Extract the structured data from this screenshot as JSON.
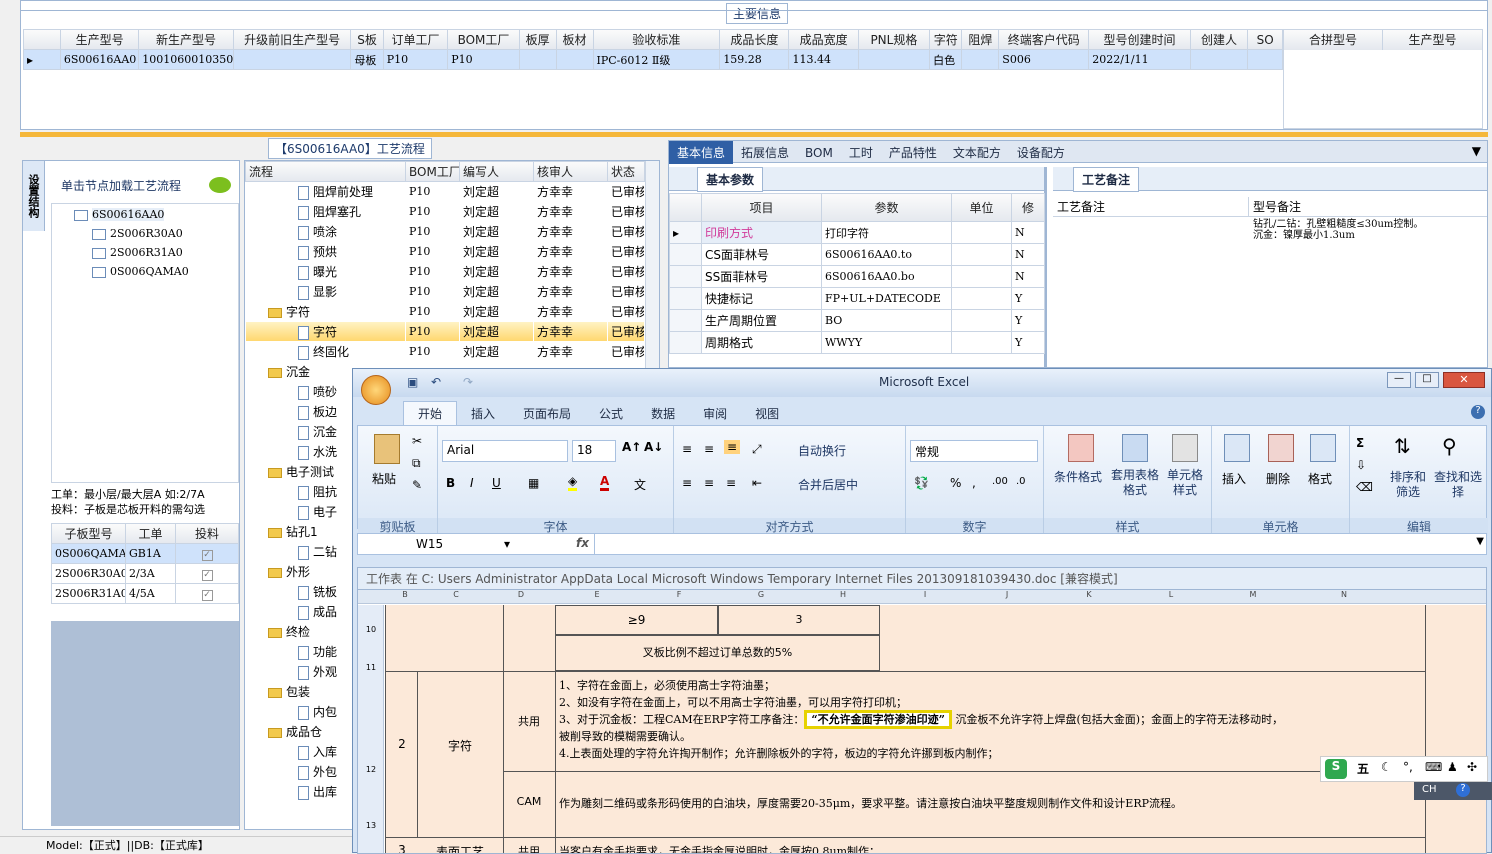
{
  "main_info": {
    "title": "主要信息",
    "columns": [
      "生产型号",
      "新生产型号",
      "升级前旧生产型号",
      "S板",
      "订单工厂",
      "BOM工厂",
      "板厚",
      "板材",
      "验收标准",
      "成品长度",
      "成品宽度",
      "PNL规格",
      "字符",
      "阻焊",
      "终端客户代码",
      "型号创建时间",
      "创建人",
      "SO"
    ],
    "row": [
      "6S00616AA0",
      "10010600103501",
      "",
      "母板",
      "P10",
      "P10",
      "",
      "",
      "IPC-6012 Ⅱ级",
      "159.28",
      "113.44",
      "",
      "白色",
      "",
      "S006",
      "2022/1/11",
      "",
      ""
    ],
    "side_columns": [
      "合拼型号",
      "生产型号"
    ]
  },
  "left_panel": {
    "vertical_tab": "设置结构",
    "hint": "单击节点加载工艺流程",
    "tree": [
      "6S00616AA0",
      "2S006R30A0",
      "2S006R31A0",
      "0S006QAMA0"
    ],
    "note1": "工单：最小层/最大层A 如:2/7A",
    "note2": "投料：子板是芯板开料的需勾选",
    "sub_columns": [
      "子板型号",
      "工单",
      "投料"
    ],
    "sub_rows": [
      [
        "0S006QAMA0",
        "GB1A"
      ],
      [
        "2S006R30A0",
        "2/3A"
      ],
      [
        "2S006R31A0",
        "4/5A"
      ]
    ]
  },
  "flow": {
    "title": "【6S00616AA0】工艺流程",
    "columns": [
      "流程",
      "BOM工厂",
      "编写人",
      "核审人",
      "状态"
    ],
    "rows": [
      {
        "lvl": 2,
        "name": "阻焊前处理",
        "b": "P10",
        "w": "刘定超",
        "r": "方幸幸",
        "s": "已审核"
      },
      {
        "lvl": 2,
        "name": "阻焊塞孔",
        "b": "P10",
        "w": "刘定超",
        "r": "方幸幸",
        "s": "已审核"
      },
      {
        "lvl": 2,
        "name": "喷涂",
        "b": "P10",
        "w": "刘定超",
        "r": "方幸幸",
        "s": "已审核"
      },
      {
        "lvl": 2,
        "name": "预烘",
        "b": "P10",
        "w": "刘定超",
        "r": "方幸幸",
        "s": "已审核"
      },
      {
        "lvl": 2,
        "name": "曝光",
        "b": "P10",
        "w": "刘定超",
        "r": "方幸幸",
        "s": "已审核"
      },
      {
        "lvl": 2,
        "name": "显影",
        "b": "P10",
        "w": "刘定超",
        "r": "方幸幸",
        "s": "已审核"
      },
      {
        "lvl": 1,
        "name": "字符",
        "b": "P10",
        "w": "刘定超",
        "r": "方幸幸",
        "s": "已审核"
      },
      {
        "lvl": 2,
        "name": "字符",
        "b": "P10",
        "w": "刘定超",
        "r": "方幸幸",
        "s": "已审核",
        "sel": true
      },
      {
        "lvl": 2,
        "name": "终固化",
        "b": "P10",
        "w": "刘定超",
        "r": "方幸幸",
        "s": "已审核"
      },
      {
        "lvl": 1,
        "name": "沉金",
        "b": "",
        "w": "",
        "r": "",
        "s": ""
      },
      {
        "lvl": 2,
        "name": "喷砂",
        "b": "",
        "w": "",
        "r": "",
        "s": ""
      },
      {
        "lvl": 2,
        "name": "板边",
        "b": "",
        "w": "",
        "r": "",
        "s": ""
      },
      {
        "lvl": 2,
        "name": "沉金",
        "b": "",
        "w": "",
        "r": "",
        "s": ""
      },
      {
        "lvl": 2,
        "name": "水洗",
        "b": "",
        "w": "",
        "r": "",
        "s": ""
      },
      {
        "lvl": 1,
        "name": "电子测试",
        "b": "",
        "w": "",
        "r": "",
        "s": ""
      },
      {
        "lvl": 2,
        "name": "阻抗",
        "b": "",
        "w": "",
        "r": "",
        "s": ""
      },
      {
        "lvl": 2,
        "name": "电子",
        "b": "",
        "w": "",
        "r": "",
        "s": ""
      },
      {
        "lvl": 1,
        "name": "钻孔1",
        "b": "",
        "w": "",
        "r": "",
        "s": ""
      },
      {
        "lvl": 2,
        "name": "二钻",
        "b": "",
        "w": "",
        "r": "",
        "s": ""
      },
      {
        "lvl": 1,
        "name": "外形",
        "b": "",
        "w": "",
        "r": "",
        "s": ""
      },
      {
        "lvl": 2,
        "name": "铣板",
        "b": "",
        "w": "",
        "r": "",
        "s": ""
      },
      {
        "lvl": 2,
        "name": "成品",
        "b": "",
        "w": "",
        "r": "",
        "s": ""
      },
      {
        "lvl": 1,
        "name": "终检",
        "b": "",
        "w": "",
        "r": "",
        "s": ""
      },
      {
        "lvl": 2,
        "name": "功能",
        "b": "",
        "w": "",
        "r": "",
        "s": ""
      },
      {
        "lvl": 2,
        "name": "外观",
        "b": "",
        "w": "",
        "r": "",
        "s": ""
      },
      {
        "lvl": 1,
        "name": "包装",
        "b": "",
        "w": "",
        "r": "",
        "s": ""
      },
      {
        "lvl": 2,
        "name": "内包",
        "b": "",
        "w": "",
        "r": "",
        "s": ""
      },
      {
        "lvl": 1,
        "name": "成品仓",
        "b": "",
        "w": "",
        "r": "",
        "s": ""
      },
      {
        "lvl": 2,
        "name": "入库",
        "b": "",
        "w": "",
        "r": "",
        "s": ""
      },
      {
        "lvl": 2,
        "name": "外包",
        "b": "",
        "w": "",
        "r": "",
        "s": ""
      },
      {
        "lvl": 2,
        "name": "出库",
        "b": "",
        "w": "",
        "r": "",
        "s": ""
      }
    ]
  },
  "right_tabs": [
    "基本信息",
    "拓展信息",
    "BOM",
    "工时",
    "产品特性",
    "文本配方",
    "设备配方"
  ],
  "basic": {
    "tab": "基本参数",
    "columns": [
      "项目",
      "参数",
      "单位",
      "修"
    ],
    "rows": [
      [
        "印刷方式",
        "打印字符",
        "",
        "N"
      ],
      [
        "CS面菲林号",
        "6S00616AA0.to",
        "",
        "N"
      ],
      [
        "SS面菲林号",
        "6S00616AA0.bo",
        "",
        "N"
      ],
      [
        "快捷标记",
        "FP+UL+DATECODE",
        "",
        "Y"
      ],
      [
        "生产周期位置",
        "BO",
        "",
        "Y"
      ],
      [
        "周期格式",
        "WWYY",
        "",
        "Y"
      ]
    ]
  },
  "remark": {
    "tab": "工艺备注",
    "col1": "工艺备注",
    "col2": "型号备注",
    "text1": "钻孔/二钻：孔壁粗糙度≤30um控制。",
    "text2": "沉金：镍厚最小1.3um"
  },
  "excel": {
    "title": "Microsoft Excel",
    "tabs": [
      "开始",
      "插入",
      "页面布局",
      "公式",
      "数据",
      "审阅",
      "视图"
    ],
    "ribbon": {
      "paste": "粘贴",
      "clipboard": "剪贴板",
      "font_name": "Arial",
      "font_size": "18",
      "font_group": "字体",
      "wrap": "自动换行",
      "merge": "合并后居中",
      "align_group": "对齐方式",
      "numfmt": "常规",
      "number_group": "数字",
      "cond": "条件格式",
      "table": "套用表格格式",
      "cellstyle": "单元格样式",
      "styles_group": "样式",
      "insert": "插入",
      "delete": "删除",
      "format": "格式",
      "cells_group": "单元格",
      "sort": "排序和筛选",
      "find": "查找和选择",
      "edit_group": "编辑"
    },
    "namebox": "W15",
    "fx": "fx",
    "doc_title": "工作表 在 C: Users Administrator AppData Local Microsoft Windows Temporary Internet Files 201309181039430.doc [兼容模式]",
    "col_letters": [
      "B",
      "C",
      "D",
      "E",
      "F",
      "G",
      "H",
      "I",
      "J",
      "K",
      "L",
      "M",
      "N"
    ],
    "row_nums": [
      "10",
      "11",
      "12",
      "13"
    ],
    "cell_ge9": "≥9",
    "cell_3": "3",
    "cell_ratio": "叉板比例不超过订单总数的5%",
    "sec2": "2",
    "sec2_name": "字符",
    "shared": "共用",
    "cam": "CAM",
    "rule1": "1、字符在金面上，必须使用高士字符油墨；",
    "rule2": "2、如没有字符在金面上，可以不用高士字符油墨，可以用字符打印机；",
    "rule3a": "3、对于沉金板：工程CAM在ERP字符工序备注：",
    "rule3_hl": "“不允许金面字符渗油印迹”",
    "rule3b": "沉金板不允许字符上焊盘(包括大金面)；金面上的字符无法移动时，",
    "rule3c": "被削导致的模糊需要确认。",
    "rule4": "4.上表面处理的字符允许掏开制作；允许删除板外的字符，板边的字符允许挪到板内制作；",
    "cam_text": "作为雕刻二维码或条形码使用的白油块，厚度需要20-35μm，要求平整。请注意按白油块平整度规则制作文件和设计ERP流程。",
    "sec3": "3",
    "sec3_name": "表面工艺",
    "sec3_text": "当客户有金手指要求，无金手指金厚说明时，金厚按0.8um制作；"
  },
  "ime": {
    "label": "五",
    "lang": "CH"
  },
  "status": "Model:【正式】||DB:【正式库】",
  "colors": {
    "accent": "#f5b73a",
    "selection": "#cfe2fb",
    "highlight": "#ffff55",
    "excel_blue": "#d6e4f5",
    "doc_bg": "#fce9d9"
  }
}
